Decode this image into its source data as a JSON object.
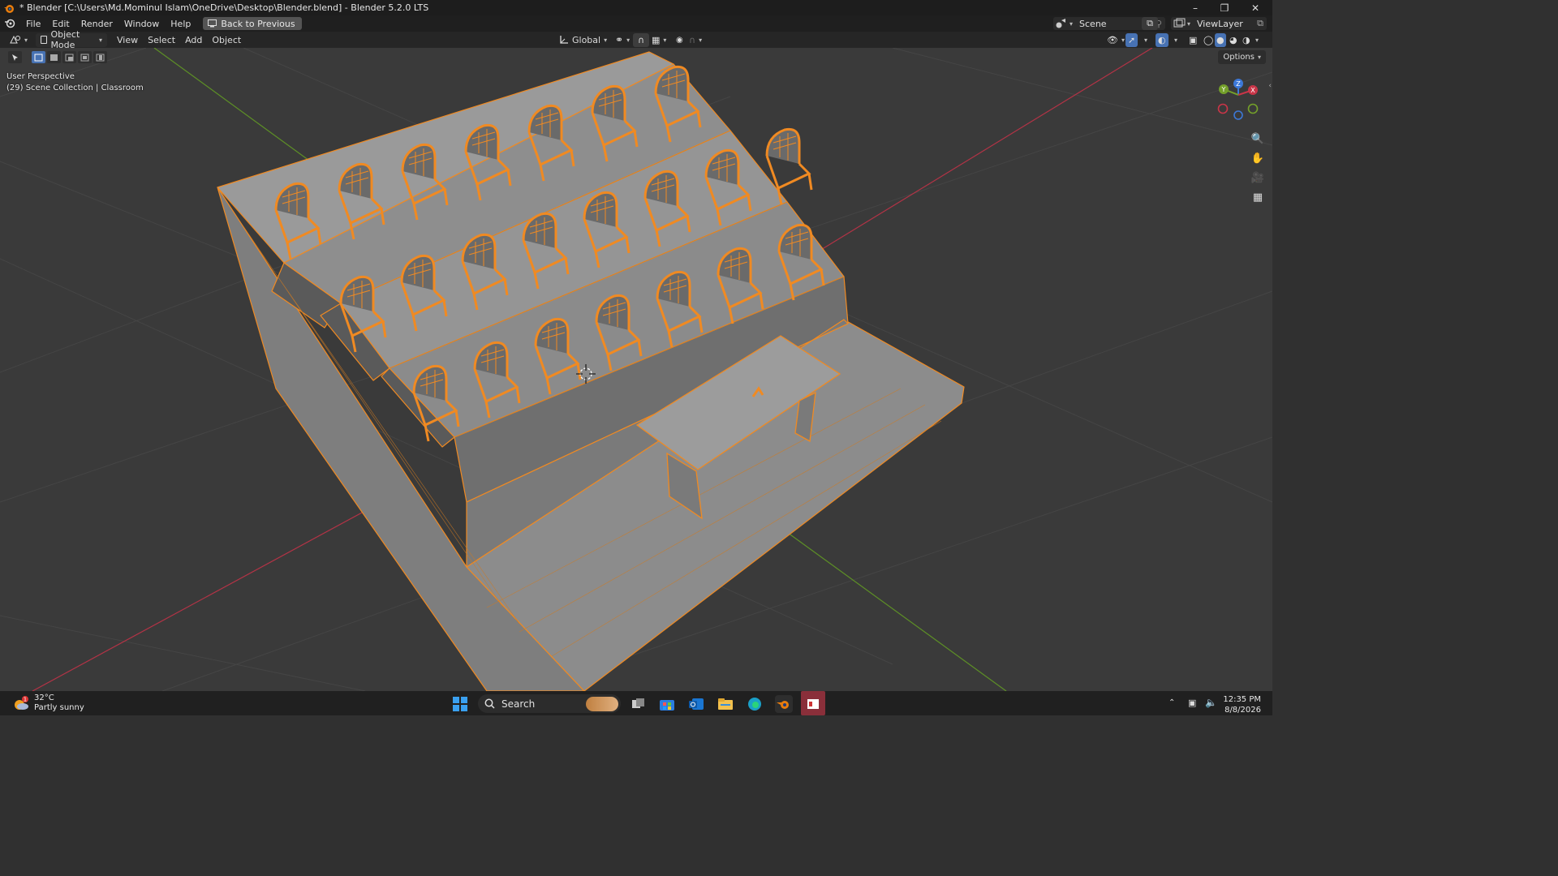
{
  "titlebar": {
    "title": "* Blender [C:\\Users\\Md.Mominul Islam\\OneDrive\\Desktop\\Blender.blend] - Blender 5.2.0 LTS"
  },
  "topbar": {
    "menus": [
      "File",
      "Edit",
      "Render",
      "Window",
      "Help"
    ],
    "back_label": "Back to Previous",
    "scene_name": "Scene",
    "view_layer": "ViewLayer"
  },
  "header": {
    "mode": "Object Mode",
    "menus": [
      "View",
      "Select",
      "Add",
      "Object"
    ],
    "orientation": "Global"
  },
  "viewport": {
    "perspective_label": "User Perspective",
    "collection_label": "(29) Scene Collection | Classroom",
    "options_label": "Options",
    "gizmo_axes": {
      "x": "X",
      "y": "Y",
      "z": "Z"
    },
    "colors": {
      "x_axis": "#c93548",
      "y_axis": "#74a02a",
      "z_axis": "#3c78d8",
      "selection": "#f0902c"
    }
  },
  "taskbar": {
    "weather_temp": "32°C",
    "weather_desc": "Partly sunny",
    "weather_badge": "1",
    "search_label": "Search",
    "time": "12:35 PM",
    "date": "8/8/2026"
  }
}
